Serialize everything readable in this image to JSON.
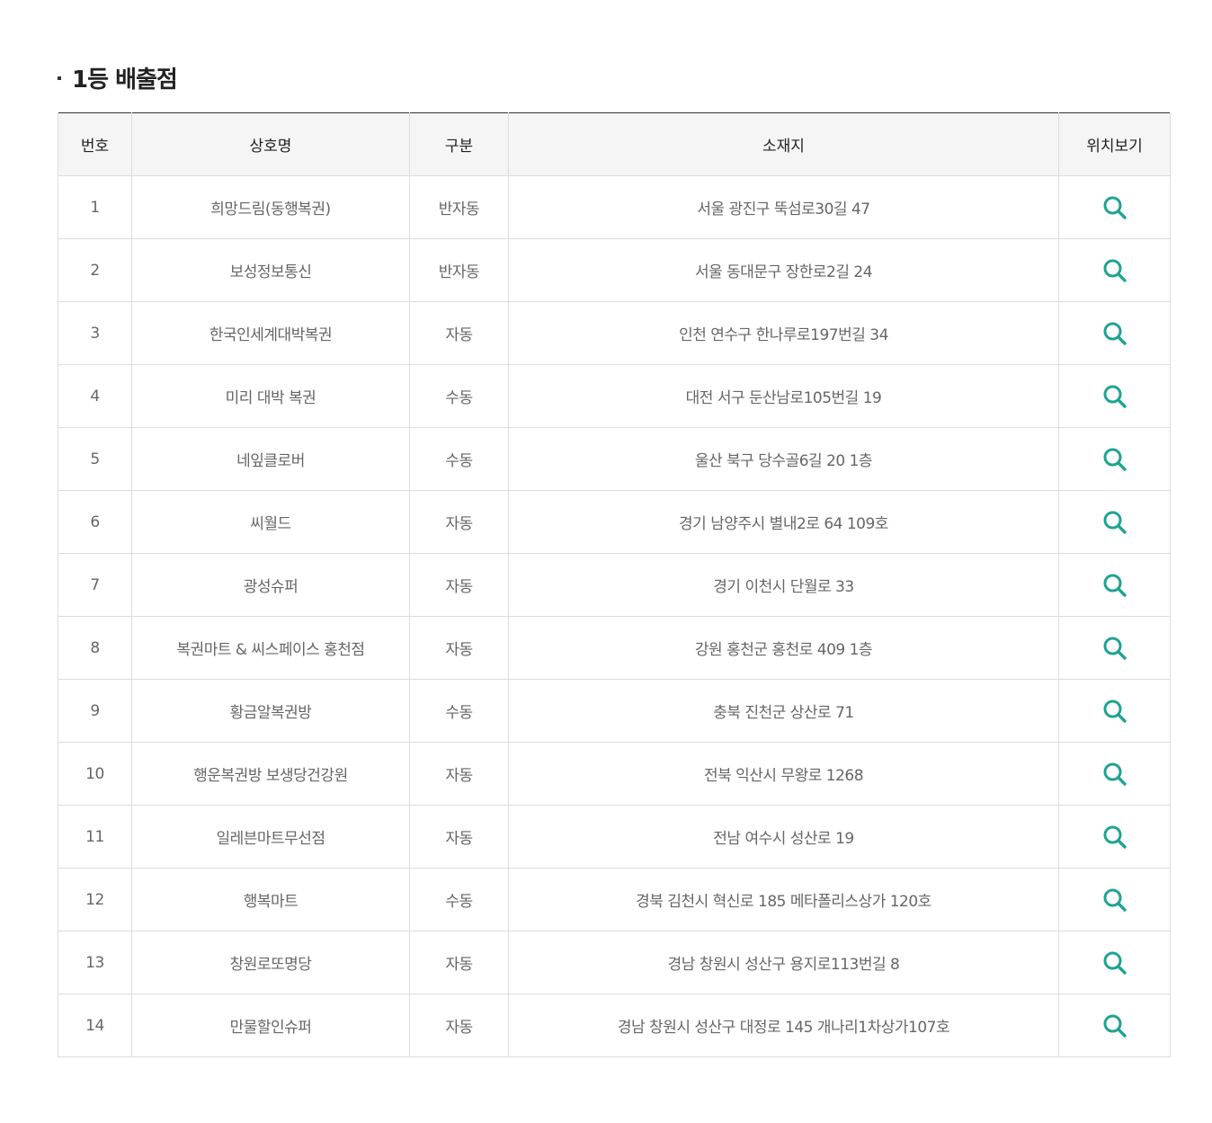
{
  "section": {
    "title": "1등 배출점"
  },
  "table": {
    "headers": {
      "no": "번호",
      "name": "상호명",
      "type": "구분",
      "address": "소재지",
      "location": "위치보기"
    },
    "rows": [
      {
        "no": "1",
        "name": "희망드림(동행복권)",
        "type": "반자동",
        "address": "서울 광진구 뚝섬로30길 47"
      },
      {
        "no": "2",
        "name": "보성정보통신",
        "type": "반자동",
        "address": "서울 동대문구 장한로2길 24"
      },
      {
        "no": "3",
        "name": "한국인세계대박복권",
        "type": "자동",
        "address": "인천 연수구 한나루로197번길 34"
      },
      {
        "no": "4",
        "name": "미리 대박 복권",
        "type": "수동",
        "address": "대전 서구 둔산남로105번길 19"
      },
      {
        "no": "5",
        "name": "네잎클로버",
        "type": "수동",
        "address": "울산 북구 당수골6길 20 1층"
      },
      {
        "no": "6",
        "name": "씨월드",
        "type": "자동",
        "address": "경기 남양주시 별내2로 64 109호"
      },
      {
        "no": "7",
        "name": "광성슈퍼",
        "type": "자동",
        "address": "경기 이천시 단월로 33"
      },
      {
        "no": "8",
        "name": "복권마트 & 씨스페이스 홍천점",
        "type": "자동",
        "address": "강원 홍천군 홍천로 409 1층"
      },
      {
        "no": "9",
        "name": "황금알복권방",
        "type": "수동",
        "address": "충북 진천군 상산로 71"
      },
      {
        "no": "10",
        "name": "행운복권방 보생당건강원",
        "type": "자동",
        "address": "전북 익산시 무왕로 1268"
      },
      {
        "no": "11",
        "name": "일레븐마트무선점",
        "type": "자동",
        "address": "전남 여수시 성산로 19"
      },
      {
        "no": "12",
        "name": "행복마트",
        "type": "수동",
        "address": "경북 김천시 혁신로 185 메타폴리스상가 120호"
      },
      {
        "no": "13",
        "name": "창원로또명당",
        "type": "자동",
        "address": "경남 창원시 성산구 용지로113번길 8"
      },
      {
        "no": "14",
        "name": "만물할인슈퍼",
        "type": "자동",
        "address": "경남 창원시 성산구 대정로 145 개나리1차상가107호"
      }
    ]
  },
  "icons": {
    "location": "search-icon"
  },
  "colors": {
    "icon": "#1fa391",
    "header_bg": "#f5f5f5",
    "top_border": "#333333",
    "cell_border": "#dddddd"
  }
}
